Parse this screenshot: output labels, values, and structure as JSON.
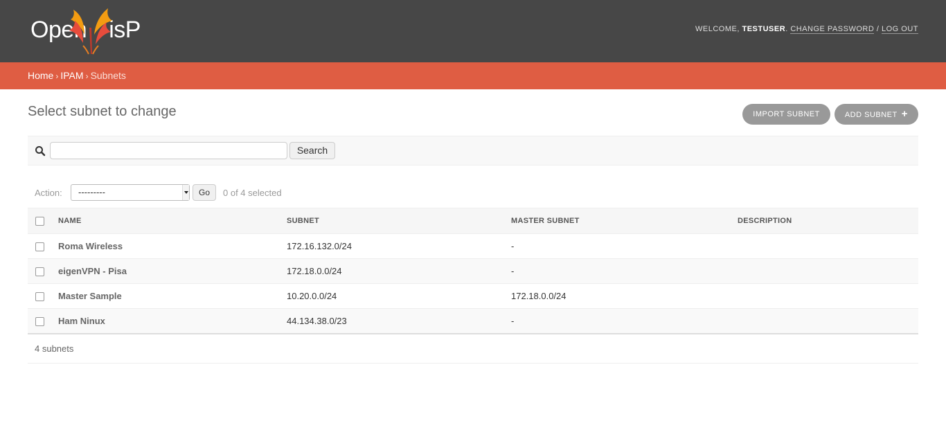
{
  "header": {
    "logo_text_left": "Open",
    "logo_text_right": "isP",
    "welcome": "Welcome,",
    "username": "testuser",
    "change_password": "Change password",
    "separator": "/",
    "logout": "Log out"
  },
  "breadcrumbs": {
    "home": "Home",
    "app": "IPAM",
    "current": "Subnets",
    "separator": "›"
  },
  "page": {
    "title": "Select subnet to change",
    "import_button": "Import subnet",
    "add_button": "Add subnet",
    "add_icon": "+"
  },
  "search": {
    "value": "",
    "button": "Search",
    "icon": "search-icon"
  },
  "actions": {
    "label": "Action:",
    "selected_option": "---------",
    "go_button": "Go",
    "counter": "0 of 4 selected"
  },
  "table": {
    "columns": [
      "Name",
      "Subnet",
      "Master subnet",
      "Description"
    ],
    "rows": [
      {
        "name": "Roma Wireless",
        "subnet": "172.16.132.0/24",
        "master_subnet": "-",
        "description": ""
      },
      {
        "name": "eigenVPN - Pisa",
        "subnet": "172.18.0.0/24",
        "master_subnet": "-",
        "description": ""
      },
      {
        "name": "Master Sample",
        "subnet": "10.20.0.0/24",
        "master_subnet": "172.18.0.0/24",
        "description": ""
      },
      {
        "name": "Ham Ninux",
        "subnet": "44.134.38.0/23",
        "master_subnet": "-",
        "description": ""
      }
    ]
  },
  "paginator": {
    "count_text": "4 subnets"
  },
  "colors": {
    "header_bg": "#474747",
    "breadcrumb_bg": "#df5d43",
    "button_bg": "#999999"
  }
}
